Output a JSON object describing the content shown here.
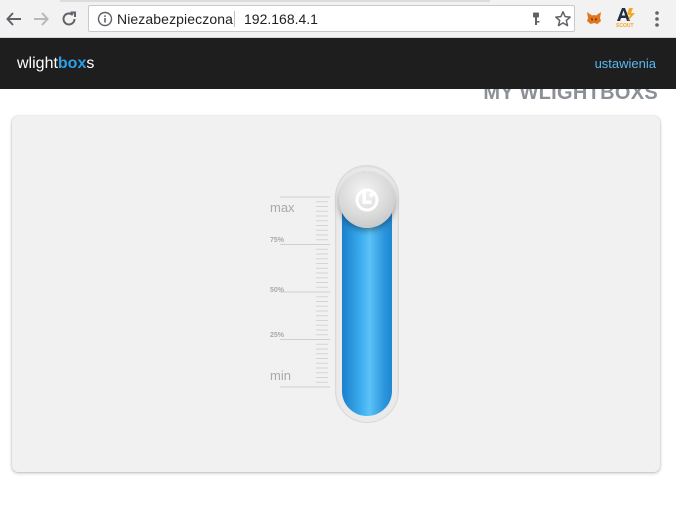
{
  "browser": {
    "security_text": "Niezabezpieczona",
    "url": "192.168.4.1",
    "extensions": [
      {
        "icon": "metamask-fox-icon"
      },
      {
        "icon": "amazon-scout-icon",
        "label": "SCOUT"
      }
    ]
  },
  "app": {
    "brand": {
      "part1": "wlight",
      "part2": "box",
      "part3": "s"
    },
    "settings_link": "ustawienia",
    "page_heading": "MY WLIGHTBOXS"
  },
  "slider": {
    "labels": {
      "max": "max",
      "p75": "75%",
      "p50": "50%",
      "p25": "25%",
      "min": "min"
    },
    "level_fraction": 1.0,
    "fill_color": "#2a9ee6",
    "knob_icon": "wlightbox-logo-icon"
  }
}
